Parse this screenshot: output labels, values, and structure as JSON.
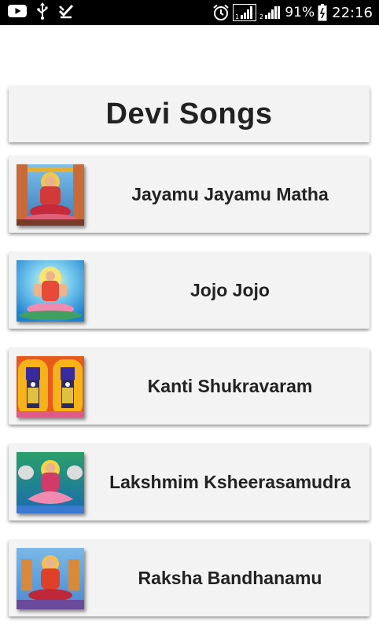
{
  "status_bar": {
    "battery": "91%",
    "time": "22:16",
    "icons": [
      "youtube-icon",
      "usb-icon",
      "download-done-icon",
      "alarm-icon",
      "signal-sim1-icon",
      "signal-sim2-icon",
      "battery-icon"
    ]
  },
  "header": {
    "title": "Devi Songs"
  },
  "songs": [
    {
      "title": "Jayamu Jayamu Matha",
      "thumbnail": "lakshmi-seated-image"
    },
    {
      "title": "Jojo Jojo",
      "thumbnail": "lakshmi-lotus-image"
    },
    {
      "title": "Kanti Shukravaram",
      "thumbnail": "balaji-image"
    },
    {
      "title": "Lakshmim Ksheerasamudra",
      "thumbnail": "lakshmi-elephants-image"
    },
    {
      "title": "Raksha Bandhanamu",
      "thumbnail": "durga-image"
    }
  ]
}
